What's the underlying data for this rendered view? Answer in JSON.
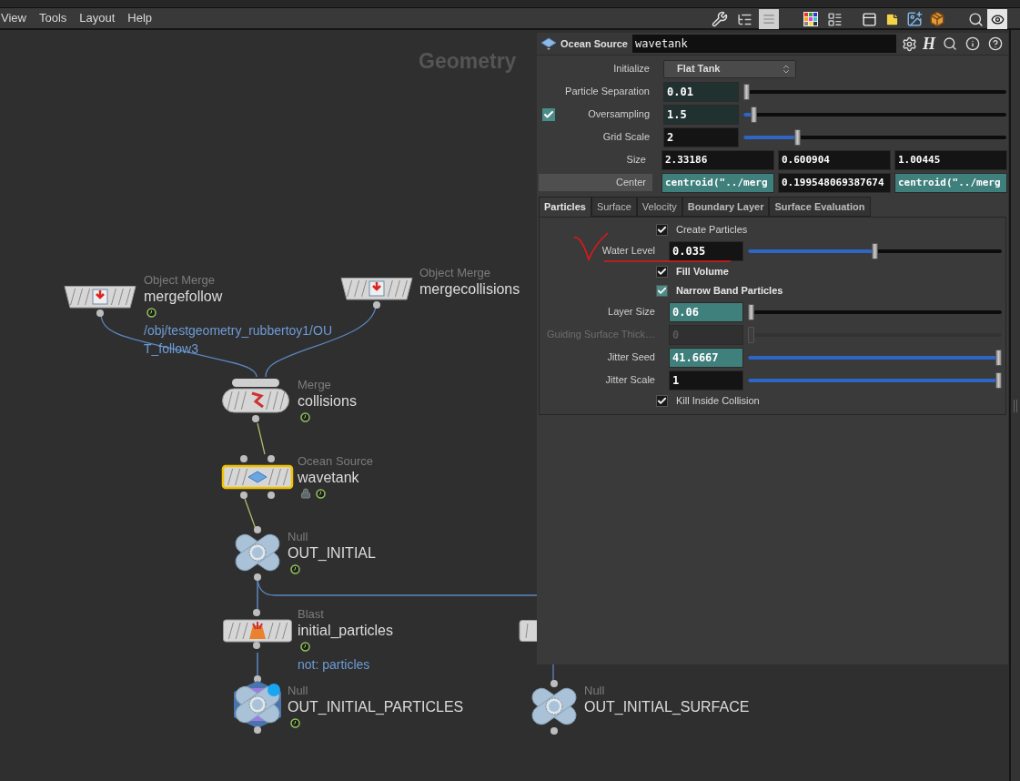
{
  "menu": [
    "View",
    "Tools",
    "Layout",
    "Help"
  ],
  "network": {
    "context_label": "Geometry",
    "nodes": [
      {
        "kind": "object_merge",
        "type_label": "Object Merge",
        "name": "mergefollow",
        "flag": true,
        "selected": false,
        "locked": false,
        "comment": "/obj/testgeometry_rubbertoy1/OUT_follow3"
      },
      {
        "kind": "object_merge",
        "type_label": "Object Merge",
        "name": "mergecollisions",
        "flag": false,
        "selected": false,
        "locked": false
      },
      {
        "kind": "merge",
        "type_label": "Merge",
        "name": "collisions",
        "flag": true,
        "selected": false,
        "locked": false
      },
      {
        "kind": "ocean_source",
        "type_label": "Ocean Source",
        "name": "wavetank",
        "flag": true,
        "selected": true,
        "locked": true
      },
      {
        "kind": "null",
        "type_label": "Null",
        "name": "OUT_INITIAL",
        "flag": true,
        "selected": false,
        "locked": false,
        "display": false
      },
      {
        "kind": "blast",
        "type_label": "Blast",
        "name": "initial_particles",
        "flag": true,
        "selected": false,
        "locked": false,
        "comment": "not: particles"
      },
      {
        "kind": "null",
        "type_label": "Null",
        "name": "OUT_INITIAL_PARTICLES",
        "flag": true,
        "selected": false,
        "locked": false,
        "display": true
      },
      {
        "kind": "null",
        "type_label": "Null",
        "name": "OUT_INITIAL_SURFACE",
        "flag": false,
        "selected": false,
        "locked": false,
        "display": false
      },
      {
        "kind": "partial"
      }
    ]
  },
  "parameter_panel": {
    "node_type": "Ocean Source",
    "node_name": "wavetank",
    "help_glyph": "H",
    "parameters": [
      {
        "kind": "menu",
        "label": "Initialize",
        "value": "Flat Tank"
      },
      {
        "kind": "slider",
        "label": "Particle Separation",
        "value": "0.01",
        "color": "#213130",
        "level": 0
      },
      {
        "kind": "slider",
        "label": "Oversampling",
        "value": "1.5",
        "color": "#213130",
        "level": 0.03,
        "enabled": true
      },
      {
        "kind": "slider",
        "label": "Grid Scale",
        "value": "2",
        "color": "#141414",
        "level": 0.2
      },
      {
        "kind": "vector",
        "label": "Size",
        "label_highlighted": false,
        "values": [
          {
            "text": "2.33186",
            "color": "#141414"
          },
          {
            "text": "0.600904",
            "color": "#141414"
          },
          {
            "text": "1.00445",
            "color": "#141414"
          }
        ]
      },
      {
        "kind": "vector",
        "label": "Center",
        "label_highlighted": true,
        "values": [
          {
            "text": "centroid(\"../merg",
            "color": "#3f7f7c"
          },
          {
            "text": "0.199548069387674",
            "color": "#141414"
          },
          {
            "text": "centroid(\"../merg",
            "color": "#3f7f7c"
          }
        ]
      }
    ],
    "tabs": [
      {
        "label": "Particles",
        "selected": true,
        "bold": true
      },
      {
        "label": "Surface",
        "selected": false,
        "bold": false
      },
      {
        "label": "Velocity",
        "selected": false,
        "bold": false
      },
      {
        "label": "Boundary Layer",
        "selected": false,
        "bold": true
      },
      {
        "label": "Surface Evaluation",
        "selected": false,
        "bold": true
      }
    ],
    "tab_parameters": [
      {
        "kind": "toggle",
        "label": "Create Particles",
        "checked": true,
        "bold": false,
        "color": "#1a1a1a"
      },
      {
        "kind": "slider",
        "label": "Water Level",
        "value": "0.035",
        "color": "#141414",
        "level": 0.5,
        "annotated": true,
        "disabled": false
      },
      {
        "kind": "toggle",
        "label": "Fill Volume",
        "checked": true,
        "bold": true,
        "color": "#1a1a1a"
      },
      {
        "kind": "toggle",
        "label": "Narrow Band Particles",
        "checked": true,
        "bold": true,
        "color": "#4a8c88"
      },
      {
        "kind": "slider",
        "label": "Layer Size",
        "value": "0.06",
        "color": "#3f7f7c",
        "level": 0,
        "annotated": false,
        "disabled": false
      },
      {
        "kind": "slider",
        "label": "Guiding Surface Thick…",
        "value": "0",
        "color": "#303030",
        "level": 0,
        "annotated": false,
        "disabled": true
      },
      {
        "kind": "slider",
        "label": "Jitter Seed",
        "value": "41.6667",
        "color": "#3f7f7c",
        "level": 1,
        "annotated": false,
        "disabled": false
      },
      {
        "kind": "slider",
        "label": "Jitter Scale",
        "value": "1",
        "color": "#141414",
        "level": 1,
        "annotated": false,
        "disabled": false
      },
      {
        "kind": "toggle",
        "label": "Kill Inside Collision",
        "checked": true,
        "bold": false,
        "color": "#1a1a1a"
      }
    ]
  }
}
